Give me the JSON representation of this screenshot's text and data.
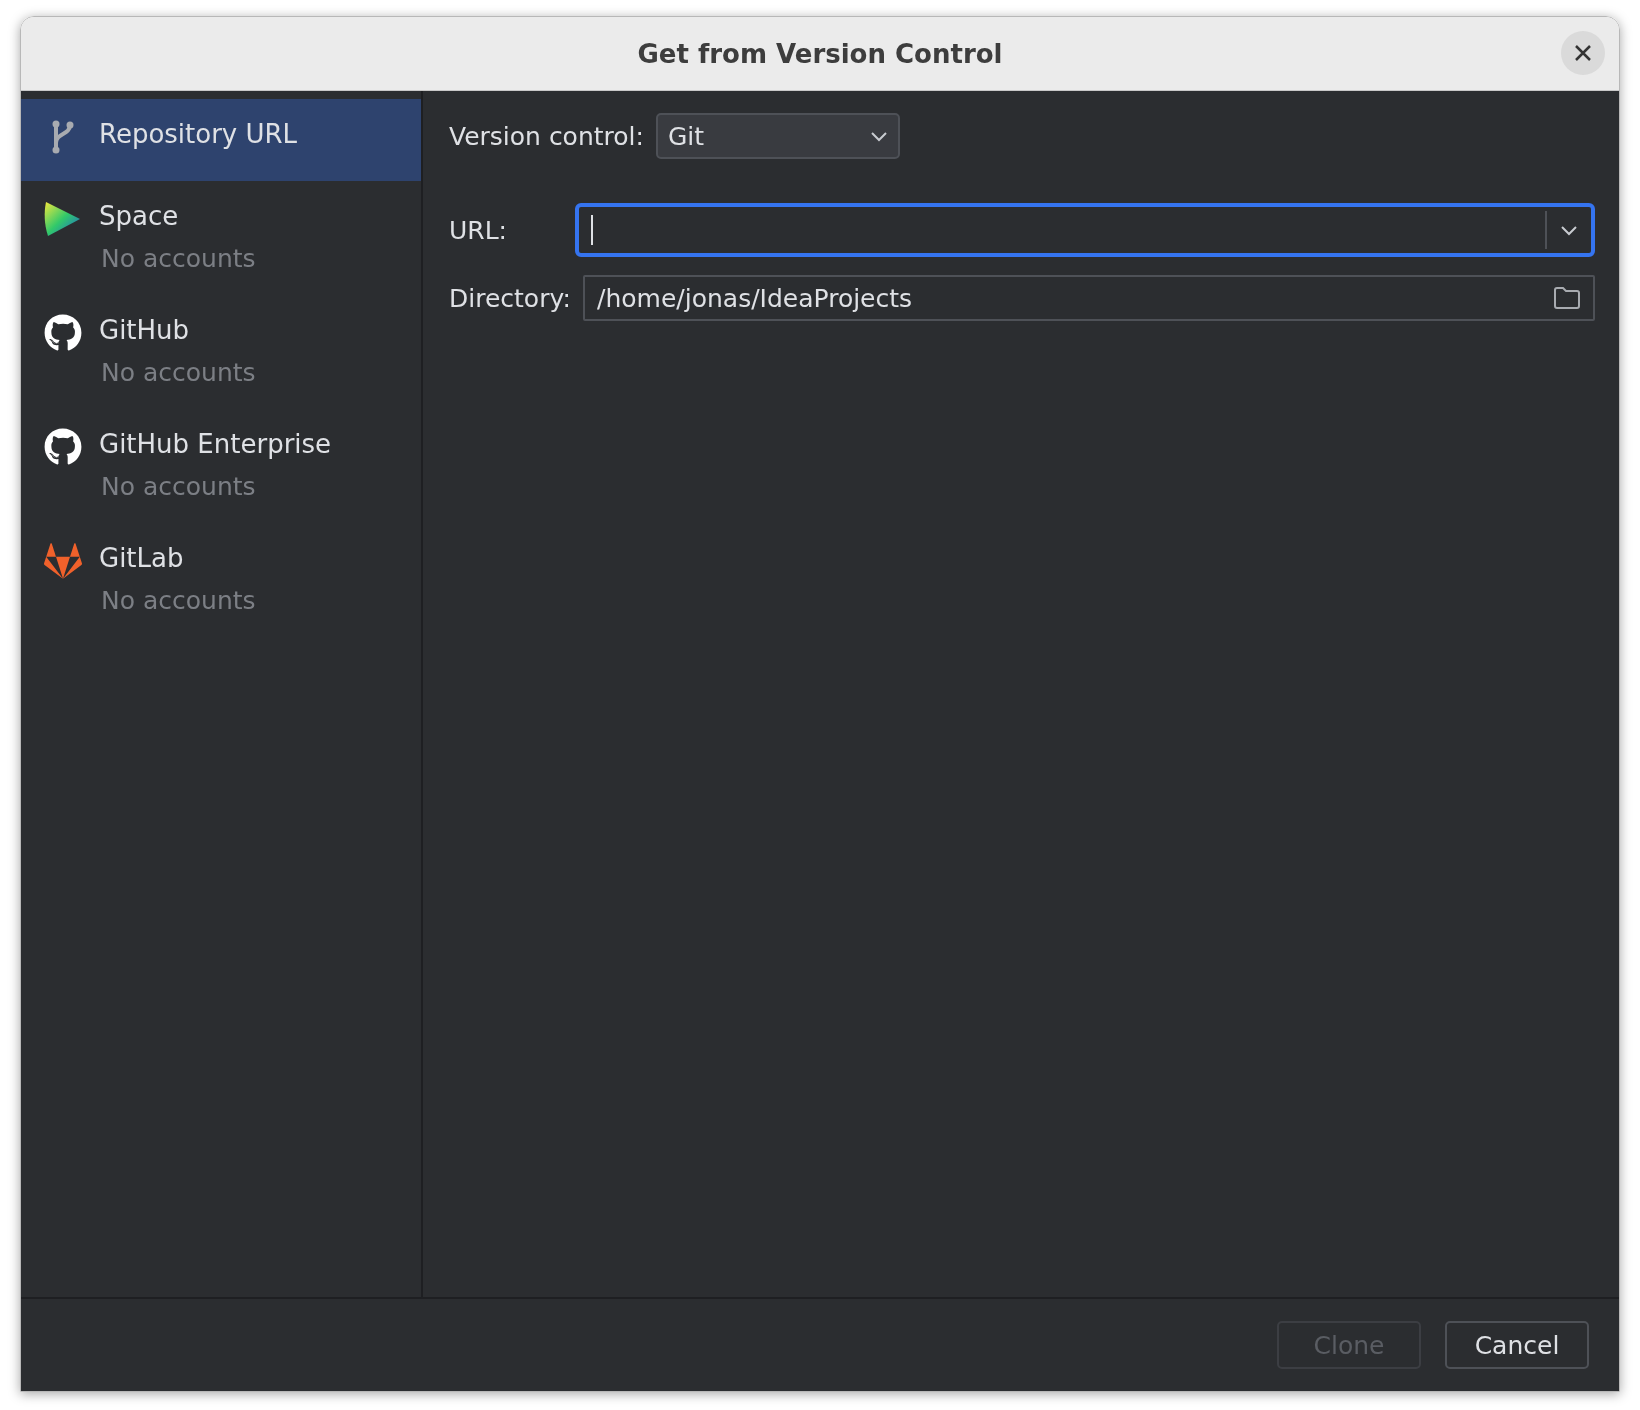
{
  "window": {
    "title": "Get from Version Control"
  },
  "sidebar": {
    "items": [
      {
        "kind": "repository",
        "title": "Repository URL",
        "selected": true
      },
      {
        "kind": "space",
        "title": "Space",
        "subtitle": "No accounts",
        "selected": false
      },
      {
        "kind": "github",
        "title": "GitHub",
        "subtitle": "No accounts",
        "selected": false
      },
      {
        "kind": "github",
        "title": "GitHub Enterprise",
        "subtitle": "No accounts",
        "selected": false
      },
      {
        "kind": "gitlab",
        "title": "GitLab",
        "subtitle": "No accounts",
        "selected": false
      }
    ]
  },
  "form": {
    "version_control": {
      "label": "Version control:",
      "value": "Git"
    },
    "url": {
      "label": "URL:",
      "focused": true
    },
    "directory": {
      "label": "Directory:",
      "value": "/home/jonas/IdeaProjects"
    }
  },
  "buttons": [
    {
      "label": "Clone",
      "disabled": true
    },
    {
      "label": "Cancel",
      "disabled": false
    }
  ]
}
